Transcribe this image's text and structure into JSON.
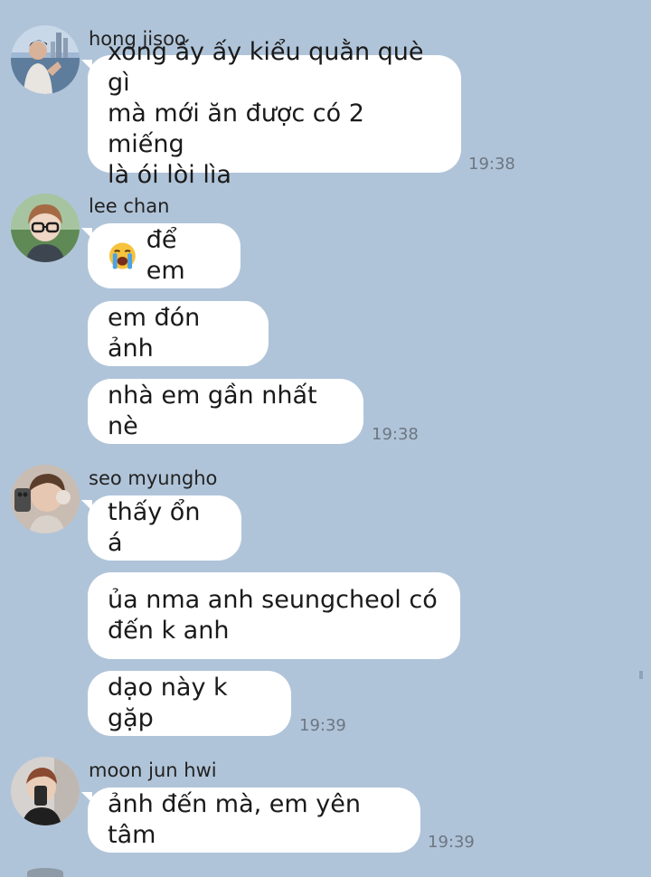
{
  "messages": [
    {
      "sender": "hong jisoo",
      "avatar_icon": "avatar-hong-jisoo",
      "bubbles": [
        "xong ấy ấy kiểu quằn què gì\nmà mới ăn được có 2 miếng\nlà ói lòi lìa"
      ],
      "time": "19:38"
    },
    {
      "sender": "lee chan",
      "avatar_icon": "avatar-lee-chan",
      "bubbles": [
        "để em",
        "em đón ảnh",
        "nhà em gần nhất nè"
      ],
      "first_bubble_emoji": "loudly-crying-face-icon",
      "time": "19:38"
    },
    {
      "sender": "seo myungho",
      "avatar_icon": "avatar-seo-myungho",
      "bubbles": [
        "thấy ổn á",
        "ủa nma anh seungcheol có\nđến k anh",
        "dạo này k gặp"
      ],
      "time": "19:39"
    },
    {
      "sender": "moon jun hwi",
      "avatar_icon": "avatar-moon-jun-hwi",
      "bubbles": [
        "ảnh đến mà, em yên tâm"
      ],
      "time": "19:39"
    }
  ],
  "colors": {
    "background": "#b0c4d9",
    "bubble": "#ffffff",
    "timestamp": "#6d7682"
  }
}
